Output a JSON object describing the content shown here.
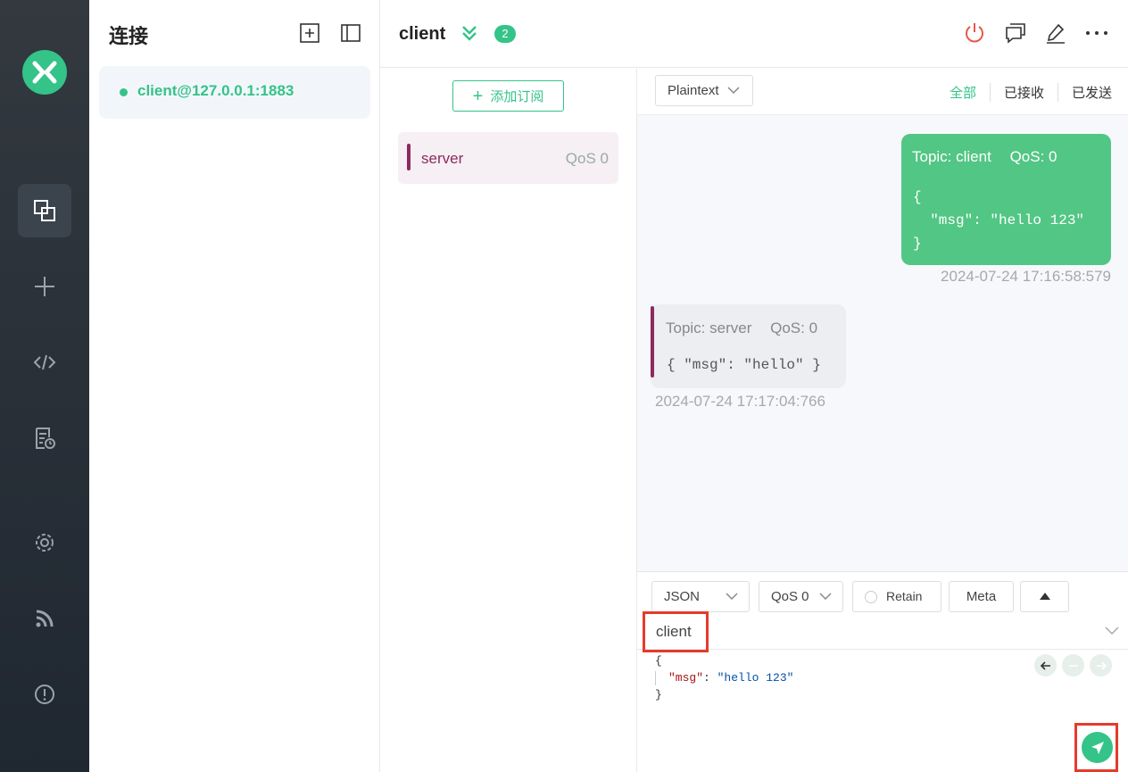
{
  "app": {
    "accent_color": "#34c388",
    "topic_color": "#8e2a5f",
    "logo_icon": "mqttx-logo-icon"
  },
  "rail": {
    "items": [
      {
        "name": "connections",
        "icon": "connections-icon",
        "active": true
      },
      {
        "name": "new-connection",
        "icon": "plus-icon",
        "active": false
      },
      {
        "name": "script",
        "icon": "code-icon",
        "active": false
      },
      {
        "name": "log",
        "icon": "log-icon",
        "active": false
      },
      {
        "name": "settings",
        "icon": "gear-icon",
        "active": false
      },
      {
        "name": "about",
        "icon": "rss-icon",
        "active": false
      },
      {
        "name": "help",
        "icon": "info-icon",
        "active": false
      }
    ]
  },
  "connections_panel": {
    "title": "连接",
    "items": [
      {
        "name": "client@127.0.0.1:1883",
        "status": "connected",
        "status_color": "#34c388"
      }
    ]
  },
  "header": {
    "title": "client",
    "badge_count": "2"
  },
  "subscriptions": {
    "add_label": "添加订阅",
    "items": [
      {
        "topic": "server",
        "qos": "QoS 0",
        "color": "#8e2a5f"
      }
    ]
  },
  "message_filter": {
    "format": "Plaintext",
    "tabs": [
      "全部",
      "已接收",
      "已发送"
    ],
    "active_tab": "全部"
  },
  "messages": [
    {
      "direction": "outgoing",
      "topic_label": "Topic: client",
      "qos_label": "QoS: 0",
      "payload_lines": [
        "{",
        "  \"msg\": \"hello 123\"",
        "}"
      ],
      "time": "2024-07-24 17:16:58:579"
    },
    {
      "direction": "incoming",
      "topic_label": "Topic: server",
      "qos_label": "QoS: 0",
      "payload_lines": [
        "{ \"msg\": \"hello\" }"
      ],
      "time": "2024-07-24 17:17:04:766"
    }
  ],
  "publish": {
    "format": "JSON",
    "qos": "QoS 0",
    "retain_label": "Retain",
    "meta_label": "Meta",
    "topic": "client",
    "payload": {
      "open": "{",
      "key": "\"msg\"",
      "colon": ": ",
      "value": "\"hello 123\"",
      "close": "}"
    }
  }
}
